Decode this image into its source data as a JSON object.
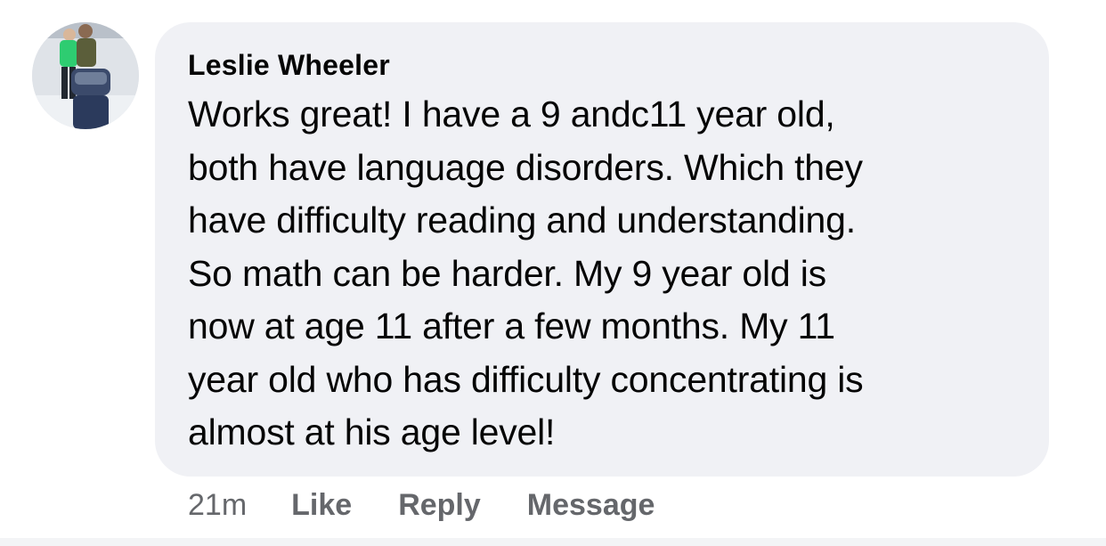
{
  "comment": {
    "author": "Leslie Wheeler",
    "text": "Works great! I have a 9 andc11 year old,\nboth have language disorders.  Which they\nhave difficulty reading and understanding.\nSo math can be harder. My 9 year old is\nnow at age 11 after a few months. My 11\nyear old who has difficulty concentrating is\nalmost at his age level!",
    "timestamp": "21m",
    "actions": {
      "like": "Like",
      "reply": "Reply",
      "message": "Message"
    }
  },
  "colors": {
    "bubble_bg": "#f0f1f5",
    "text": "#050505",
    "meta": "#65676b"
  }
}
